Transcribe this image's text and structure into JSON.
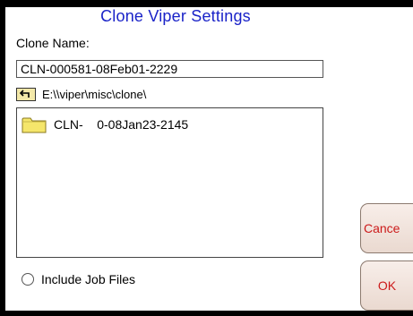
{
  "dialog": {
    "title": "Clone Viper Settings",
    "clone_name_label": "Clone Name:",
    "clone_name_value": "CLN-000581-08Feb01-2229",
    "current_path": "E:\\\\viper\\misc\\clone\\",
    "files": [
      {
        "name": "CLN-    0-08Jan23-2145",
        "icon": "folder-icon"
      }
    ],
    "include_job_files_label": "Include Job Files",
    "include_job_files_checked": false
  },
  "buttons": {
    "cancel_label": "Cance",
    "ok_label": "OK"
  },
  "colors": {
    "title": "#1a23c8",
    "button_text": "#cc1a1a",
    "folder": "#f5e66b"
  }
}
